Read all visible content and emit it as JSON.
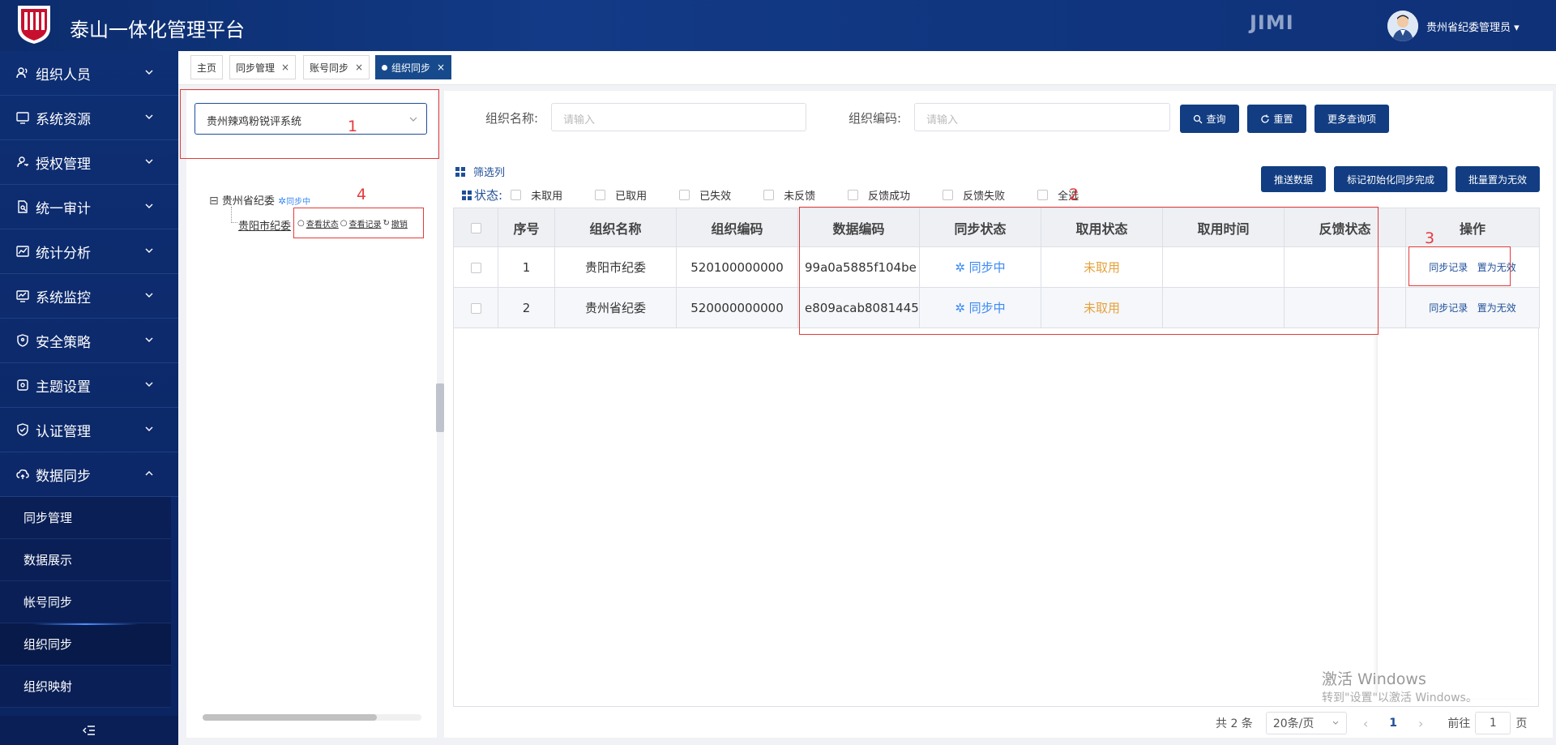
{
  "header": {
    "title": "泰山一体化管理平台",
    "brand": "JIMI",
    "user": "贵州省纪委管理员",
    "user_caret": "▾"
  },
  "sidebar": {
    "menus": [
      {
        "label": "组织人员",
        "icon": "users-icon"
      },
      {
        "label": "系统资源",
        "icon": "monitor-icon"
      },
      {
        "label": "授权管理",
        "icon": "user-key-icon"
      },
      {
        "label": "统一审计",
        "icon": "audit-doc-icon"
      },
      {
        "label": "统计分析",
        "icon": "chart-icon"
      },
      {
        "label": "系统监控",
        "icon": "monitor-chart-icon"
      },
      {
        "label": "安全策略",
        "icon": "shield-icon"
      },
      {
        "label": "主题设置",
        "icon": "theme-icon"
      },
      {
        "label": "认证管理",
        "icon": "shield-check-icon"
      },
      {
        "label": "数据同步",
        "icon": "cloud-sync-icon"
      }
    ],
    "submenus": [
      "同步管理",
      "数据展示",
      "帐号同步",
      "组织同步",
      "组织映射"
    ],
    "active_submenu": "组织同步"
  },
  "tabs": [
    {
      "label": "主页",
      "closable": false
    },
    {
      "label": "同步管理",
      "closable": true
    },
    {
      "label": "账号同步",
      "closable": true
    },
    {
      "label": "组织同步",
      "closable": true,
      "active": true
    }
  ],
  "tab_close": "×",
  "left": {
    "system_select": "贵州辣鸡粉锐评系统",
    "annotation_1": "1",
    "annotation_4": "4",
    "tree_root": "贵州省纪委",
    "tree_root_toggle": "⊟",
    "tree_root_status": "同步中",
    "tree_child": "贵阳市纪委",
    "tree_ops": [
      "查看状态",
      "查看记录",
      "撤销"
    ]
  },
  "search": {
    "org_name_label": "组织名称:",
    "org_name_placeholder": "请输入",
    "org_code_label": "组织编码:",
    "org_code_placeholder": "请输入",
    "query": "查询",
    "reset": "重置",
    "more": "更多查询项"
  },
  "grid": {
    "filter_columns": "筛选列",
    "status_label": "状态:",
    "status_options": [
      "未取用",
      "已取用",
      "已失效",
      "未反馈",
      "反馈成功",
      "反馈失败",
      "全选"
    ],
    "actions": [
      "推送数据",
      "标记初始化同步完成",
      "批量置为无效"
    ],
    "annotation_2": "2",
    "annotation_3": "3",
    "columns": [
      "序号",
      "组织名称",
      "组织编码",
      "数据编码",
      "同步状态",
      "取用状态",
      "取用时间",
      "反馈状态",
      "操作"
    ],
    "rows": [
      {
        "no": "1",
        "name": "贵阳市纪委",
        "code": "520100000000",
        "data_code": "99a0a5885f104be",
        "sync": "同步中",
        "use": "未取用",
        "use_time": "",
        "feedback": "",
        "ops": [
          "同步记录",
          "置为无效"
        ]
      },
      {
        "no": "2",
        "name": "贵州省纪委",
        "code": "520000000000",
        "data_code": "e809acab8081445",
        "sync": "同步中",
        "use": "未取用",
        "use_time": "",
        "feedback": "",
        "ops": [
          "同步记录",
          "置为无效"
        ]
      }
    ]
  },
  "pager": {
    "total": "共 2 条",
    "page_size": "20条/页",
    "prev": "‹",
    "current": "1",
    "next": "›",
    "goto": "前往",
    "goto_value": "1",
    "page_unit": "页"
  },
  "watermark": {
    "line1": "激活 Windows",
    "line2": "转到\"设置\"以激活 Windows。"
  },
  "colors": {
    "header_bg": "#0f3178",
    "sidebar_bg": "#0e2f74",
    "primary": "#123d82",
    "syncing": "#3b8af5",
    "not_used": "#e6a23c",
    "annotation": "#e43b3b"
  }
}
